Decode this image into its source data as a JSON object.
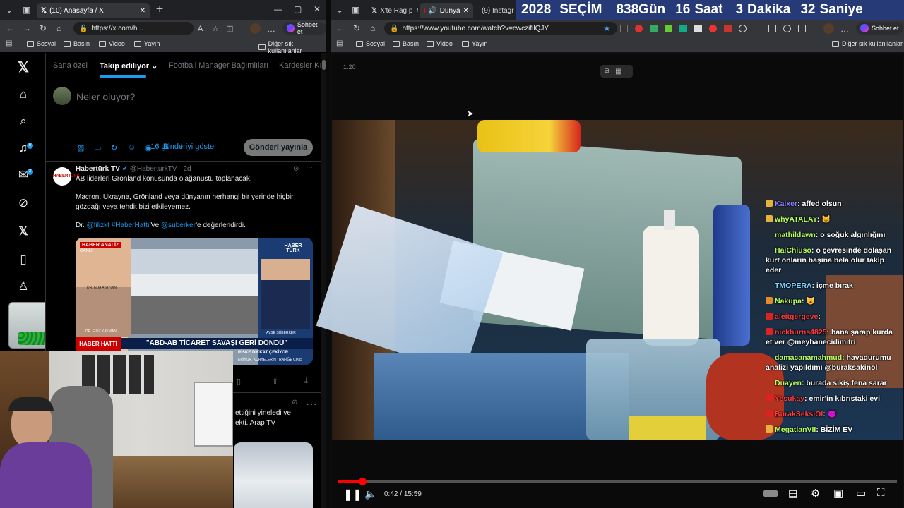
{
  "left_window": {
    "tab_label": "(10) Anasayfa / X",
    "url": "https://x.com/h...",
    "copilot_label": "Sohbet et",
    "favorites": [
      "Sosyal",
      "Basın",
      "Video",
      "Yayın"
    ],
    "favorites_more": "Diğer sık kullanılanlar"
  },
  "right_window": {
    "tabs": [
      {
        "label": "X'te Ragıp"
      },
      {
        "label": "Dünya"
      },
      {
        "label": "(9) Instagr"
      }
    ],
    "url": "https://www.youtube.com/watch?v=cwczifilQJY",
    "copilot_label": "Sohbet et",
    "favorites": [
      "Sosyal",
      "Basın",
      "Video",
      "Yayın"
    ],
    "favorites_more": "Diğer sık kullanılanlar"
  },
  "countdown": {
    "year": "2028",
    "label": "SEÇİM",
    "days": "838",
    "days_unit": "Gün",
    "hours": "16",
    "hours_unit": "Saat",
    "minutes": "3",
    "minutes_unit": "Dakika",
    "seconds": "32",
    "seconds_unit": "Saniye"
  },
  "x": {
    "tabs": [
      "Sana özel",
      "Takip ediliyor",
      "Football Manager Bağımlıları",
      "Kardeşler Kı"
    ],
    "compose_placeholder": "Neler oluyor?",
    "post_button": "Gönderi yayınla",
    "show_more": "16 gönderiyi göster",
    "notif_count": "6",
    "msg_count": "2",
    "tweet": {
      "author": "Habertürk TV",
      "handle": "@HaberturkTV",
      "time": "· 2d",
      "line1": "AB liderleri Grönland konusunda olağanüstü toplanacak.",
      "line2": "Macron: Ukrayna, Grönland veya dünyanın herhangi bir yerinde hiçbir gözdağı veya tehdit bizi etkileyemez.",
      "line3_prefix": "Dr.",
      "mention1": "@filizkt",
      "hashtag": "#HaberHattı",
      "line3_mid": "'Ve",
      "mention2": "@suberker",
      "line3_suffix": "'e değerlendirdi.",
      "image": {
        "badge": "HABER ANALİZ",
        "badge2": "CANLI",
        "logo": "HABER TÜRK",
        "guest1": "DR. EDA AYAYDIN",
        "guest2": "DR. FİLİZ KAYMAN",
        "host": "AYŞE SÜBERKER",
        "show_logo": "HABER HATTI",
        "headline": "\"ABD-AB TİCARET SAVAŞI GERİ DÖNDÜ\"",
        "ticker1": "RİSKE DİKKAT ÇEKİYOR",
        "ticker2": "ERİYOR, KURYELERİN TRAFİĞE ÇIKIŞ"
      }
    },
    "tweet2": {
      "line1": "ettiğini yineledi ve",
      "line2": "ekti. Arap TV"
    }
  },
  "player": {
    "timecode_overlay": "1.20",
    "current_time": "0:42",
    "duration": "15:59",
    "progress": 0.044
  },
  "chat": [
    {
      "user": "Kaixer",
      "text": "affed olsun",
      "color": "#8a7cff",
      "badge": "sub"
    },
    {
      "user": "whyATALAY",
      "text": "😺",
      "color": "#b8ff5a",
      "badge": "sub"
    },
    {
      "user": "mathildawn",
      "text": "o soğuk algınlığını",
      "color": "#b8ff5a",
      "badge": ""
    },
    {
      "user": "HaiChiuso",
      "text": "o çevresinde dolaşan kurt onların başına bela olur takip eder",
      "color": "#b8ff5a",
      "badge": ""
    },
    {
      "user": "TMOPERA",
      "text": "içme bırak",
      "color": "#7fd3ff",
      "badge": ""
    },
    {
      "user": "Nakupa",
      "text": "😺",
      "color": "#b8ff5a",
      "badge": "multi"
    },
    {
      "user": "aleitgergeve",
      "text": "",
      "color": "#ff3b3b",
      "badge": "red"
    },
    {
      "user": "nickburns4825",
      "text": "bana şarap kurda et ver @meyhanecidimitri",
      "color": "#ff3b3b",
      "badge": "red"
    },
    {
      "user": "damacanamahmud",
      "text": "havadurumu analizi yapıldımı @buraksakinol",
      "color": "#b8ff5a",
      "badge": ""
    },
    {
      "user": "Duayen",
      "text": "burada sikiş fena sarar",
      "color": "#b8ff5a",
      "badge": ""
    },
    {
      "user": "Yesukay",
      "text": "emir'in kıbrıstaki evi",
      "color": "#ff3b3b",
      "badge": "red"
    },
    {
      "user": "BurakSeksiOl",
      "text": "😈",
      "color": "#ff3b3b",
      "badge": "red"
    },
    {
      "user": "MegatlanVII",
      "text": "BİZİM EV",
      "color": "#b8ff5a",
      "badge": "sub"
    }
  ],
  "colors": {
    "x_blue": "#1d9bf0",
    "yt_red": "#ff0000",
    "countdown_bg": "#263a78"
  }
}
